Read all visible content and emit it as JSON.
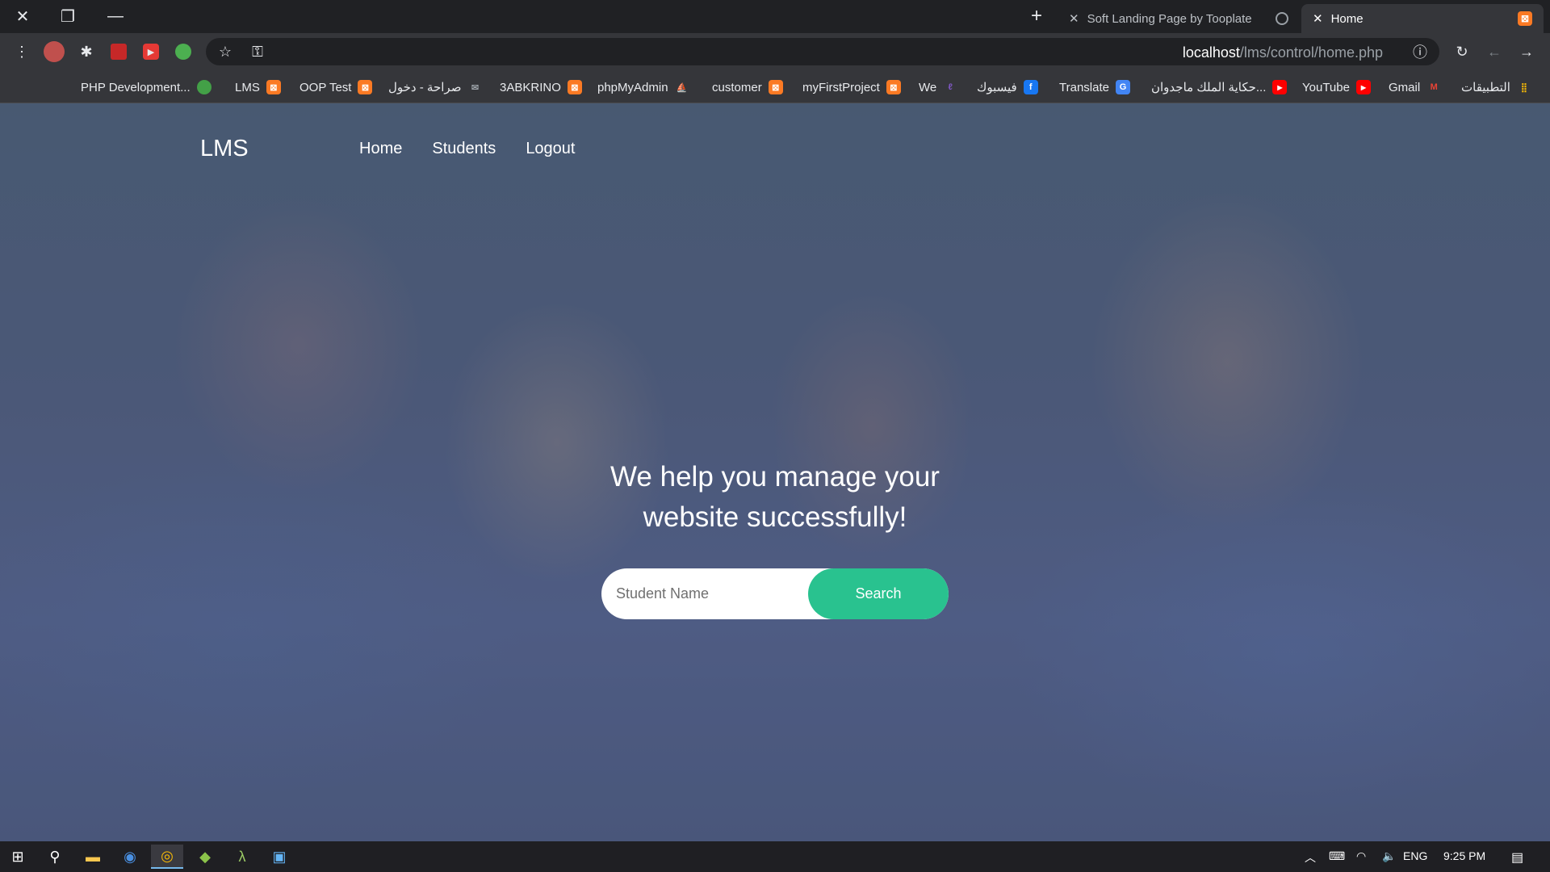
{
  "browser": {
    "tabs": [
      {
        "label": "Soft Landing Page by Tooplate",
        "active": false,
        "favicon": "globe-icon"
      },
      {
        "label": "Home",
        "active": true,
        "favicon": "xampp-icon"
      }
    ],
    "url": {
      "host": "localhost",
      "path": "/lms/control/home.php"
    },
    "bookmarks": [
      {
        "label": "التطبيقات",
        "icon": "apps-grid-icon"
      },
      {
        "label": "Gmail",
        "icon": "gmail-icon"
      },
      {
        "label": "YouTube",
        "icon": "youtube-icon"
      },
      {
        "label": "حكاية الملك ماجدوان...",
        "icon": "youtube-icon"
      },
      {
        "label": "Translate",
        "icon": "translate-icon"
      },
      {
        "label": "فيسبوك",
        "icon": "facebook-icon"
      },
      {
        "label": "We",
        "icon": "we-icon"
      },
      {
        "label": "myFirstProject",
        "icon": "xampp-icon"
      },
      {
        "label": "customer",
        "icon": "xampp-icon"
      },
      {
        "label": "phpMyAdmin",
        "icon": "phpmyadmin-icon"
      },
      {
        "label": "3ABKRINO",
        "icon": "xampp-icon"
      },
      {
        "label": "صراحة - دخول",
        "icon": "mail-icon"
      },
      {
        "label": "OOP Test",
        "icon": "xampp-icon"
      },
      {
        "label": "LMS",
        "icon": "xampp-icon"
      },
      {
        "label": "PHP Development...",
        "icon": "globe-green-icon"
      }
    ]
  },
  "site": {
    "brand": "LMS",
    "nav": [
      "Home",
      "Students",
      "Logout"
    ],
    "hero_line1": "We help you manage your",
    "hero_line2": "website successfully!",
    "search": {
      "placeholder": "Student Name",
      "button": "Search"
    }
  },
  "taskbar": {
    "language": "ENG",
    "time": "9:25 PM"
  },
  "colors": {
    "accent": "#29c28f",
    "browser_bg": "#202124",
    "toolbar_bg": "#35363a"
  }
}
